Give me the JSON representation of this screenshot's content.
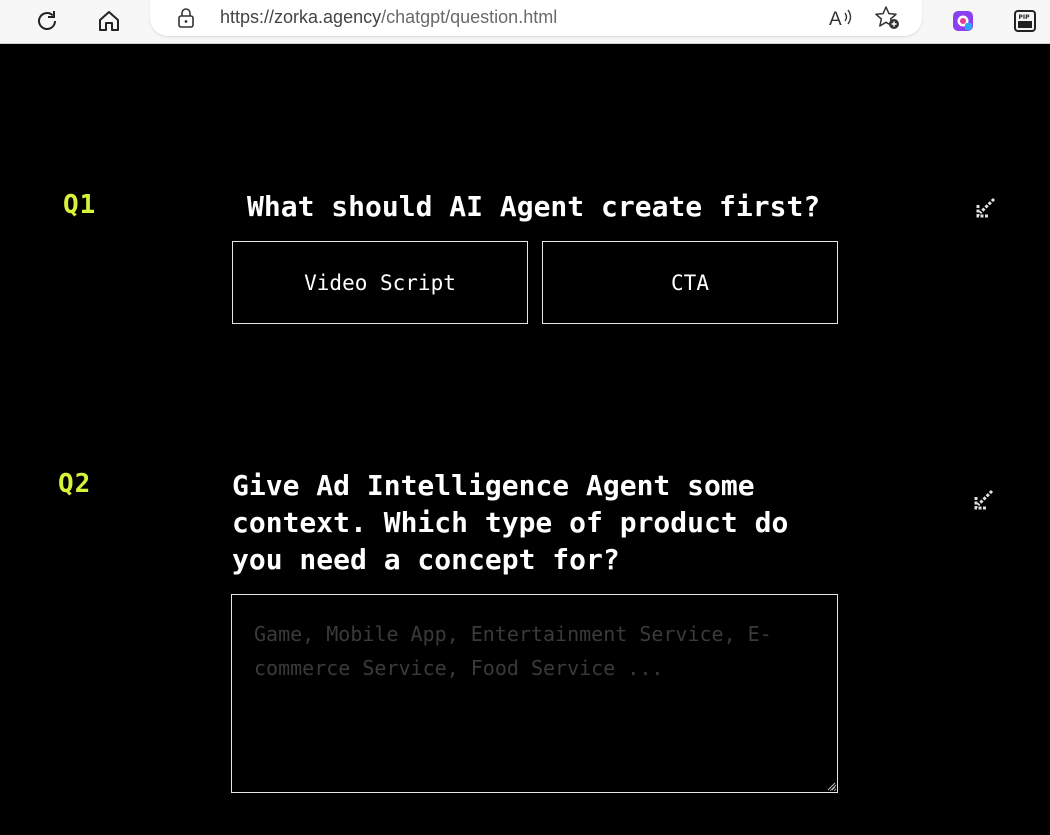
{
  "browser": {
    "url_base": "https://zorka.agency",
    "url_path": "/chatgpt/question.html",
    "icons": [
      "refresh-icon",
      "home-icon",
      "lock-icon",
      "read-aloud-icon",
      "add-favorite-icon",
      "copilot-icon",
      "pip-icon"
    ],
    "pip_label": "PIP"
  },
  "questions": [
    {
      "number": "Q1",
      "text": "What should AI Agent create first?",
      "options": [
        "Video Script",
        "CTA"
      ]
    },
    {
      "number": "Q2",
      "text_lines": [
        "Give Ad Intelligence Agent some",
        "context. Which type of product do",
        "you need a concept for?"
      ],
      "placeholder": "Game, Mobile App, Entertainment Service, E-commerce Service, Food Service ..."
    }
  ],
  "colors": {
    "accent": "#d8f23a",
    "background": "#000000",
    "text": "#ffffff",
    "border": "#e6e6e6"
  }
}
